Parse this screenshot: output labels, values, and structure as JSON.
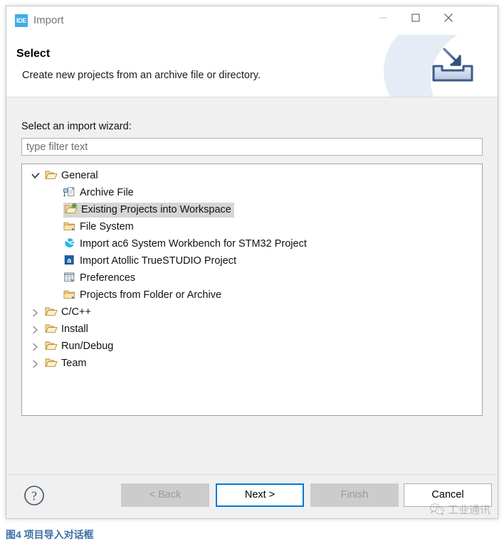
{
  "titlebar": {
    "app_icon_text": "IDE",
    "title": "Import",
    "minimize_label": "Minimize",
    "maximize_label": "Maximize",
    "close_label": "Close"
  },
  "header": {
    "title": "Select",
    "description": "Create new projects from an archive file or directory.",
    "banner_icon": "import-tray-icon"
  },
  "body": {
    "wizard_label": "Select an import wizard:",
    "filter": {
      "value": "",
      "placeholder": "type filter text"
    },
    "tree": [
      {
        "label": "General",
        "level": 1,
        "icon": "open-folder-icon",
        "twisty": "expanded",
        "selected": false
      },
      {
        "label": "Archive File",
        "level": 2,
        "icon": "archive-file-icon",
        "twisty": "none",
        "selected": false
      },
      {
        "label": "Existing Projects into Workspace",
        "level": 2,
        "icon": "import-project-icon",
        "twisty": "none",
        "selected": true
      },
      {
        "label": "File System",
        "level": 2,
        "icon": "folder-icon",
        "twisty": "none",
        "selected": false
      },
      {
        "label": "Import ac6 System Workbench for STM32 Project",
        "level": 2,
        "icon": "ac6-globe-icon",
        "twisty": "none",
        "selected": false
      },
      {
        "label": "Import Atollic TrueSTUDIO Project",
        "level": 2,
        "icon": "atollic-a-icon",
        "twisty": "none",
        "selected": false
      },
      {
        "label": "Preferences",
        "level": 2,
        "icon": "preferences-icon",
        "twisty": "none",
        "selected": false
      },
      {
        "label": "Projects from Folder or Archive",
        "level": 2,
        "icon": "folder-icon",
        "twisty": "none",
        "selected": false
      },
      {
        "label": "C/C++",
        "level": 1,
        "icon": "open-folder-icon",
        "twisty": "collapsed",
        "selected": false
      },
      {
        "label": "Install",
        "level": 1,
        "icon": "open-folder-icon",
        "twisty": "collapsed",
        "selected": false
      },
      {
        "label": "Run/Debug",
        "level": 1,
        "icon": "open-folder-icon",
        "twisty": "collapsed",
        "selected": false
      },
      {
        "label": "Team",
        "level": 1,
        "icon": "open-folder-icon",
        "twisty": "collapsed",
        "selected": false
      }
    ]
  },
  "footer": {
    "help_icon": "question-mark-icon",
    "buttons": [
      {
        "id": "back",
        "label": "< Back",
        "state": "disabled"
      },
      {
        "id": "next",
        "label": "Next >",
        "state": "focused"
      },
      {
        "id": "finish",
        "label": "Finish",
        "state": "disabled"
      },
      {
        "id": "cancel",
        "label": "Cancel",
        "state": "enabled"
      }
    ]
  },
  "watermark": {
    "icon": "wechat-icon",
    "text": "工业通讯"
  },
  "caption": {
    "text": "图4 项目导入对话框"
  },
  "colors": {
    "accent": "#0078d7",
    "app_icon": "#3eacea",
    "caption": "#3b6ea8",
    "selection": "#d6d6d6",
    "dialog_bg": "#f0f0f0"
  }
}
